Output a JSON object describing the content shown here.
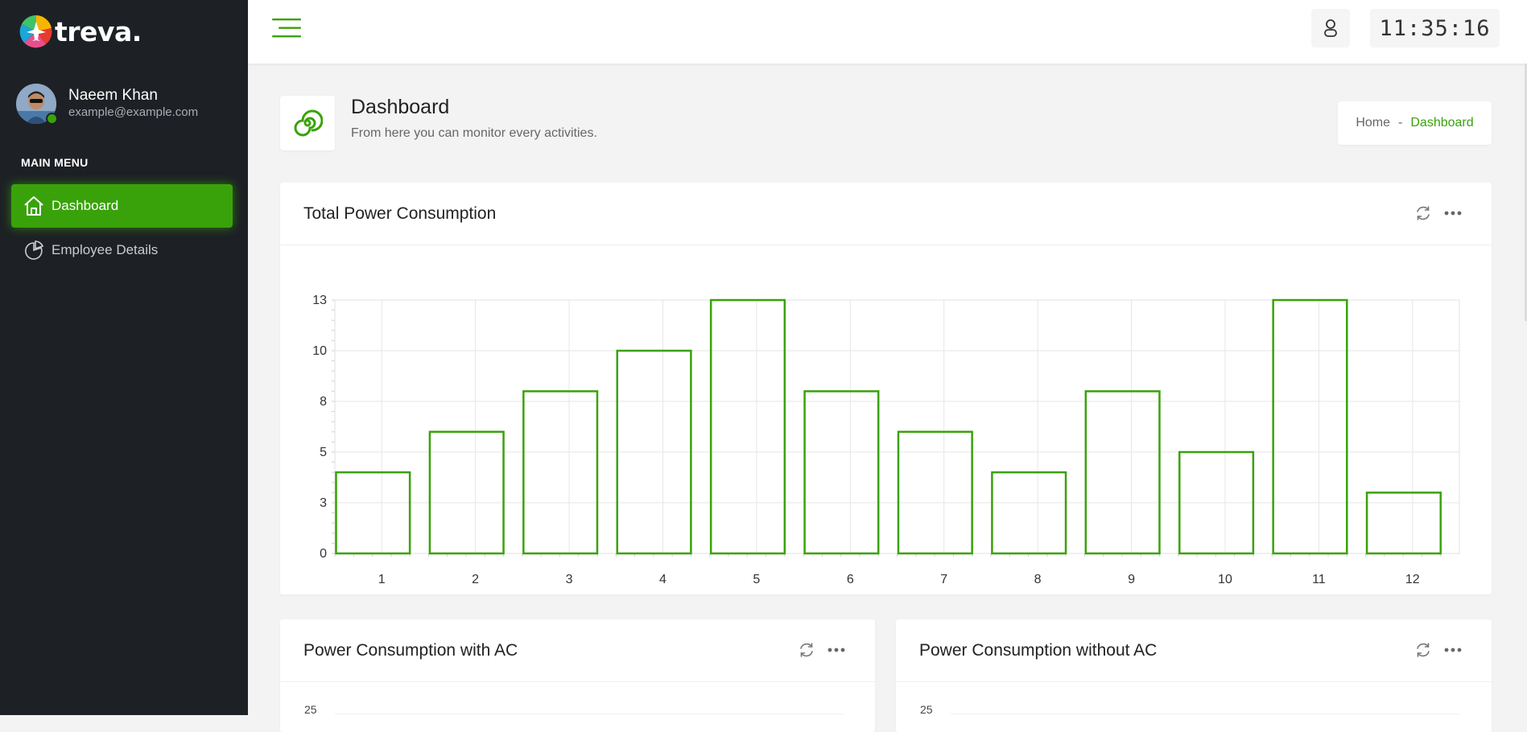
{
  "app": {
    "name": "treva."
  },
  "user": {
    "name": "Naeem Khan",
    "email": "example@example.com"
  },
  "sidebar": {
    "menu_title": "MAIN MENU",
    "items": [
      {
        "label": "Dashboard",
        "icon": "home-icon",
        "active": true
      },
      {
        "label": "Employee Details",
        "icon": "pie-chart-icon",
        "active": false
      }
    ]
  },
  "topbar": {
    "clock": "11:35:16"
  },
  "page": {
    "title": "Dashboard",
    "subtitle": "From here you can monitor every activities.",
    "icon": "spiral-icon"
  },
  "breadcrumb": {
    "home": "Home",
    "separator": "-",
    "current": "Dashboard"
  },
  "cards": {
    "total": {
      "title": "Total Power Consumption"
    },
    "with_ac": {
      "title": "Power Consumption with AC",
      "first_tick": "25"
    },
    "without_ac": {
      "title": "Power Consumption without AC",
      "first_tick": "25"
    }
  },
  "colors": {
    "accent": "#39a20a",
    "sidebar": "#1d2125"
  },
  "chart_data": {
    "type": "bar",
    "title": "Total Power Consumption",
    "categories": [
      "1",
      "2",
      "3",
      "4",
      "5",
      "6",
      "7",
      "8",
      "9",
      "10",
      "11",
      "12"
    ],
    "values": [
      4,
      6,
      8,
      10,
      12.5,
      8,
      6,
      4,
      8,
      5,
      12.5,
      3
    ],
    "ylim": [
      0,
      12.5
    ],
    "yticks": [
      0,
      2.5,
      5,
      7.5,
      10,
      12.5
    ],
    "ytick_labels": [
      "0",
      "3",
      "5",
      "8",
      "10",
      "13"
    ],
    "xlabel": "",
    "ylabel": "",
    "grid": true,
    "bar_style": "outline",
    "bar_color": "#39a20a"
  }
}
